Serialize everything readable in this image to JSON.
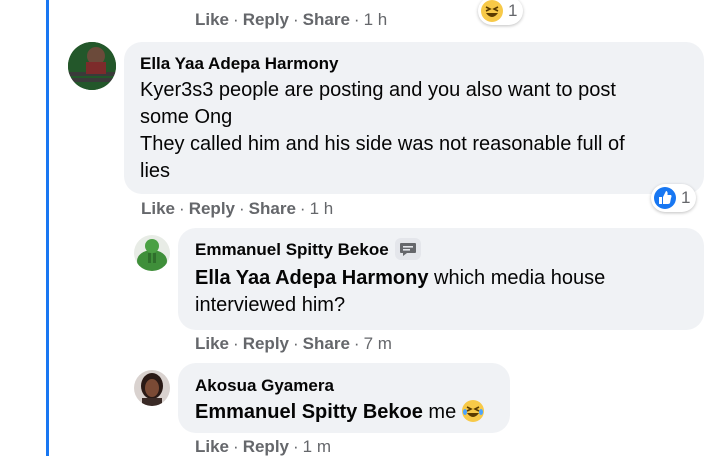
{
  "thread_color": "#1877f2",
  "top_actions": {
    "like": "Like",
    "reply": "Reply",
    "share": "Share",
    "time": "1 h",
    "reaction_icon": "laugh-emoji",
    "reaction_count": "1"
  },
  "comments": [
    {
      "author": "Ella Yaa Adepa Harmony",
      "lines": [
        "Kyer3s3 people are posting and you also want to post",
        "some Ong",
        "They called him and his side was not reasonable full of",
        "lies"
      ],
      "actions": {
        "like": "Like",
        "reply": "Reply",
        "share": "Share",
        "time": "1 h"
      },
      "reaction_icon": "like-thumb",
      "reaction_count": "1"
    },
    {
      "author": "Emmanuel Spitty Bekoe",
      "author_badge_icon": "message-icon",
      "mention": "Ella Yaa Adepa Harmony",
      "text_line1": "which media house",
      "text_line2": "interviewed him?",
      "actions": {
        "like": "Like",
        "reply": "Reply",
        "share": "Share",
        "time": "7 m"
      }
    },
    {
      "author": "Akosua Gyamera",
      "mention": "Emmanuel Spitty Bekoe",
      "text": "me",
      "emoji_icon": "laugh-emoji",
      "actions": {
        "like": "Like",
        "reply": "Reply",
        "time": "1 m"
      }
    }
  ]
}
